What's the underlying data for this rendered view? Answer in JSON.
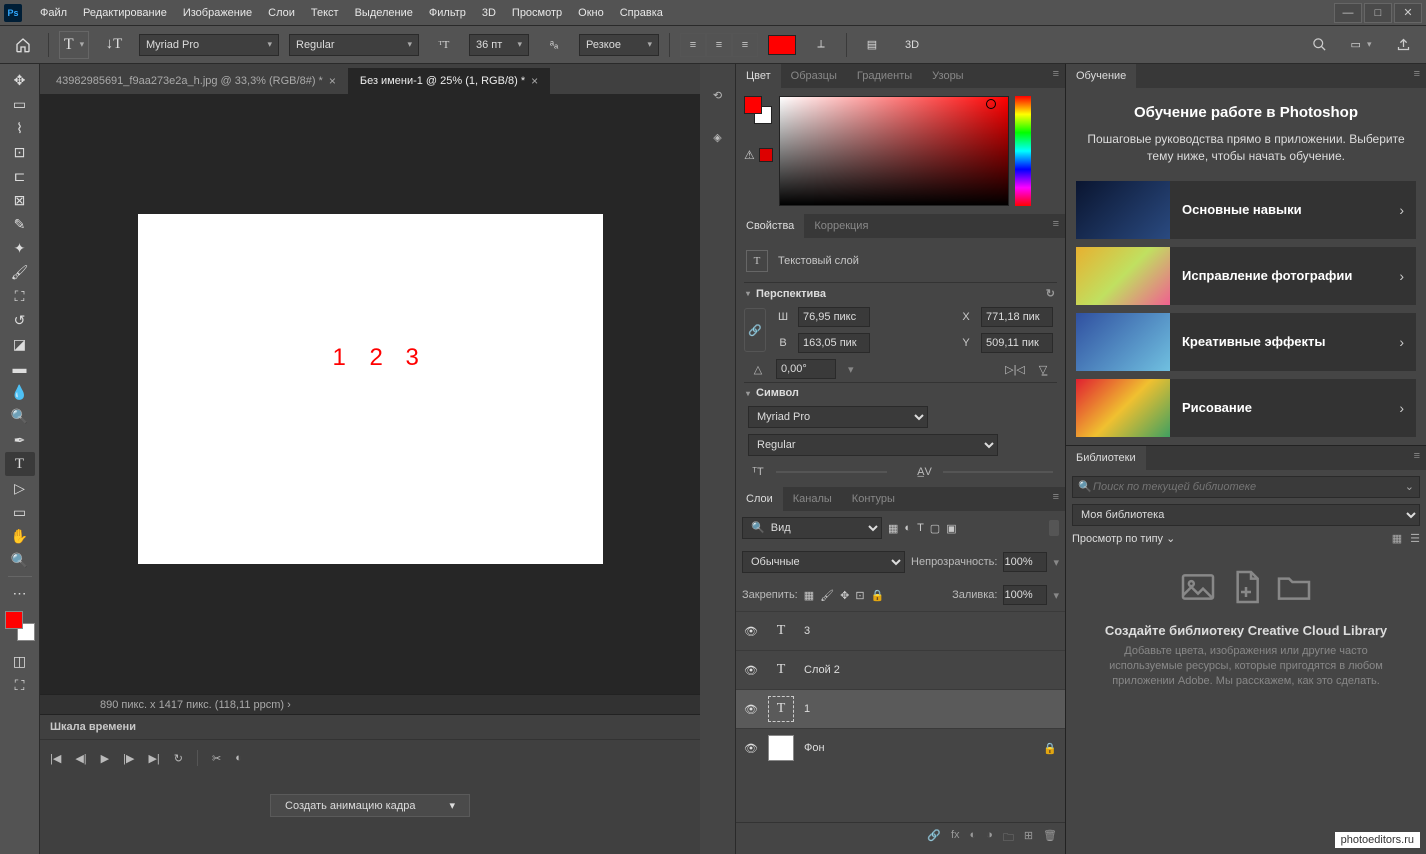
{
  "menubar": {
    "items": [
      "Файл",
      "Редактирование",
      "Изображение",
      "Слои",
      "Текст",
      "Выделение",
      "Фильтр",
      "3D",
      "Просмотр",
      "Окно",
      "Справка"
    ]
  },
  "optionsbar": {
    "font_family": "Myriad Pro",
    "font_style": "Regular",
    "font_size": "36 пт",
    "aa_mode": "Резкое",
    "text_color": "#ff0000",
    "three_d_label": "3D"
  },
  "tabs": [
    {
      "label": "43982985691_f9aa273e2a_h.jpg @ 33,3% (RGB/8#) *",
      "active": false
    },
    {
      "label": "Без имени-1 @ 25% (1, RGB/8) *",
      "active": true
    }
  ],
  "canvas": {
    "t1": "1",
    "t2": "2",
    "t3": "3"
  },
  "status": "890 пикс. x 1417 пикс. (118,11 ppcm)  ›",
  "timeline": {
    "title": "Шкала времени",
    "create": "Создать анимацию кадра"
  },
  "color_panel": {
    "tabs": [
      "Цвет",
      "Образцы",
      "Градиенты",
      "Узоры"
    ]
  },
  "properties_panel": {
    "tabs": [
      "Свойства",
      "Коррекция"
    ],
    "layer_type": "Текстовый слой",
    "section_transform": "Перспектива",
    "W_lbl": "Ш",
    "W": "76,95 пикс",
    "H_lbl": "В",
    "H": "163,05 пик",
    "X_lbl": "X",
    "X": "771,18 пик",
    "Y_lbl": "Y",
    "Y": "509,11 пик",
    "angle": "0,00°",
    "section_char": "Символ",
    "font": "Myriad Pro",
    "style": "Regular"
  },
  "layers_panel": {
    "tabs": [
      "Слои",
      "Каналы",
      "Контуры"
    ],
    "filter_label": "Вид",
    "blend_mode": "Обычные",
    "opacity_label": "Непрозрачность:",
    "opacity": "100%",
    "lock_label": "Закрепить:",
    "fill_label": "Заливка:",
    "fill": "100%",
    "layers": [
      {
        "name": "3",
        "type": "text",
        "selected": false
      },
      {
        "name": "Слой 2",
        "type": "text",
        "selected": false
      },
      {
        "name": "1",
        "type": "text",
        "selected": true
      },
      {
        "name": "Фон",
        "type": "bg",
        "selected": false,
        "locked": true
      }
    ]
  },
  "learn_panel": {
    "tab": "Обучение",
    "title": "Обучение работе в Photoshop",
    "desc": "Пошаговые руководства прямо в приложении. Выберите тему ниже, чтобы начать обучение.",
    "cards": [
      {
        "title": "Основные навыки"
      },
      {
        "title": "Исправление фотографии"
      },
      {
        "title": "Креативные эффекты"
      },
      {
        "title": "Рисование"
      }
    ]
  },
  "libraries_panel": {
    "tab": "Библиотеки",
    "search_placeholder": "Поиск по текущей библиотеке",
    "current": "Моя библиотека",
    "view_label": "Просмотр по типу",
    "cta_title": "Создайте библиотеку Creative Cloud Library",
    "cta_desc": "Добавьте цвета, изображения или другие часто используемые ресурсы, которые пригодятся в любом приложении Adobe. Мы расскажем, как это сделать."
  },
  "watermark": "photoeditors.ru"
}
